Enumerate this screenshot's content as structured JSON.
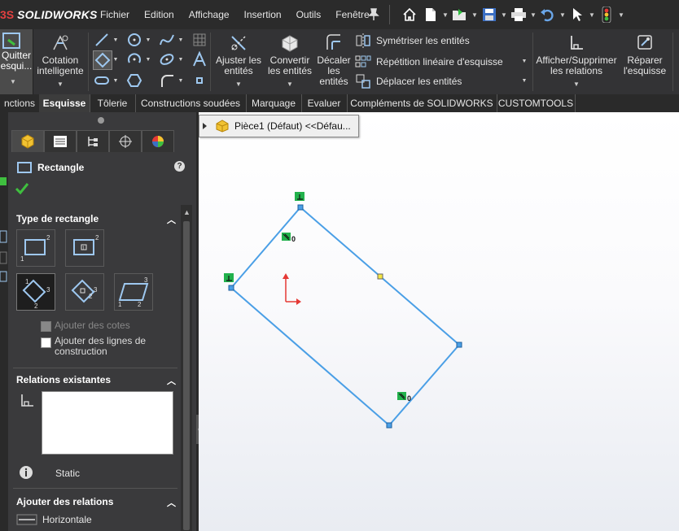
{
  "app": {
    "brand_prefix": "3S",
    "brand": "SOLIDWORKS"
  },
  "menu": [
    "Fichier",
    "Edition",
    "Affichage",
    "Insertion",
    "Outils",
    "Fenêtre"
  ],
  "commands": {
    "quit_label_line1": "Quitter",
    "quit_label_line2": "esqui...",
    "smart_dim_line1": "Cotation",
    "smart_dim_line2": "intelligente",
    "trim_line1": "Ajuster les",
    "trim_line2": "entités",
    "convert_line1": "Convertir",
    "convert_line2": "les entités",
    "offset_line1": "Décaler",
    "offset_line2": "les",
    "offset_line3": "entités",
    "mirror": "Symétriser les entités",
    "linear_pattern": "Répétition linéaire d'esquisse",
    "move": "Déplacer les entités",
    "relations_line1": "Afficher/Supprimer",
    "relations_line2": "les relations",
    "repair_line1": "Réparer",
    "repair_line2": "l'esquisse"
  },
  "tabs": [
    "nctions",
    "Esquisse",
    "Tôlerie",
    "Constructions soudées",
    "Marquage",
    "Evaluer",
    "Compléments de SOLIDWORKS",
    "CUSTOMTOOLS"
  ],
  "active_tab_index": 1,
  "property_manager": {
    "title": "Rectangle",
    "help": "?",
    "group_type": "Type de rectangle",
    "add_dimensions": "Ajouter des cotes",
    "add_construction_line1": "Ajouter des lignes de",
    "add_construction_line2": "construction",
    "group_existing": "Relations existantes",
    "status": "Static",
    "group_add": "Ajouter des relations",
    "horizontal": "Horizontale"
  },
  "tree": {
    "item": "Pièce1 (Défaut) <<Défau..."
  },
  "sketch": {
    "relation_zero_1": "0",
    "relation_zero_2": "0",
    "color_line": "#4a9fe6",
    "color_relation": "#22b14c"
  }
}
